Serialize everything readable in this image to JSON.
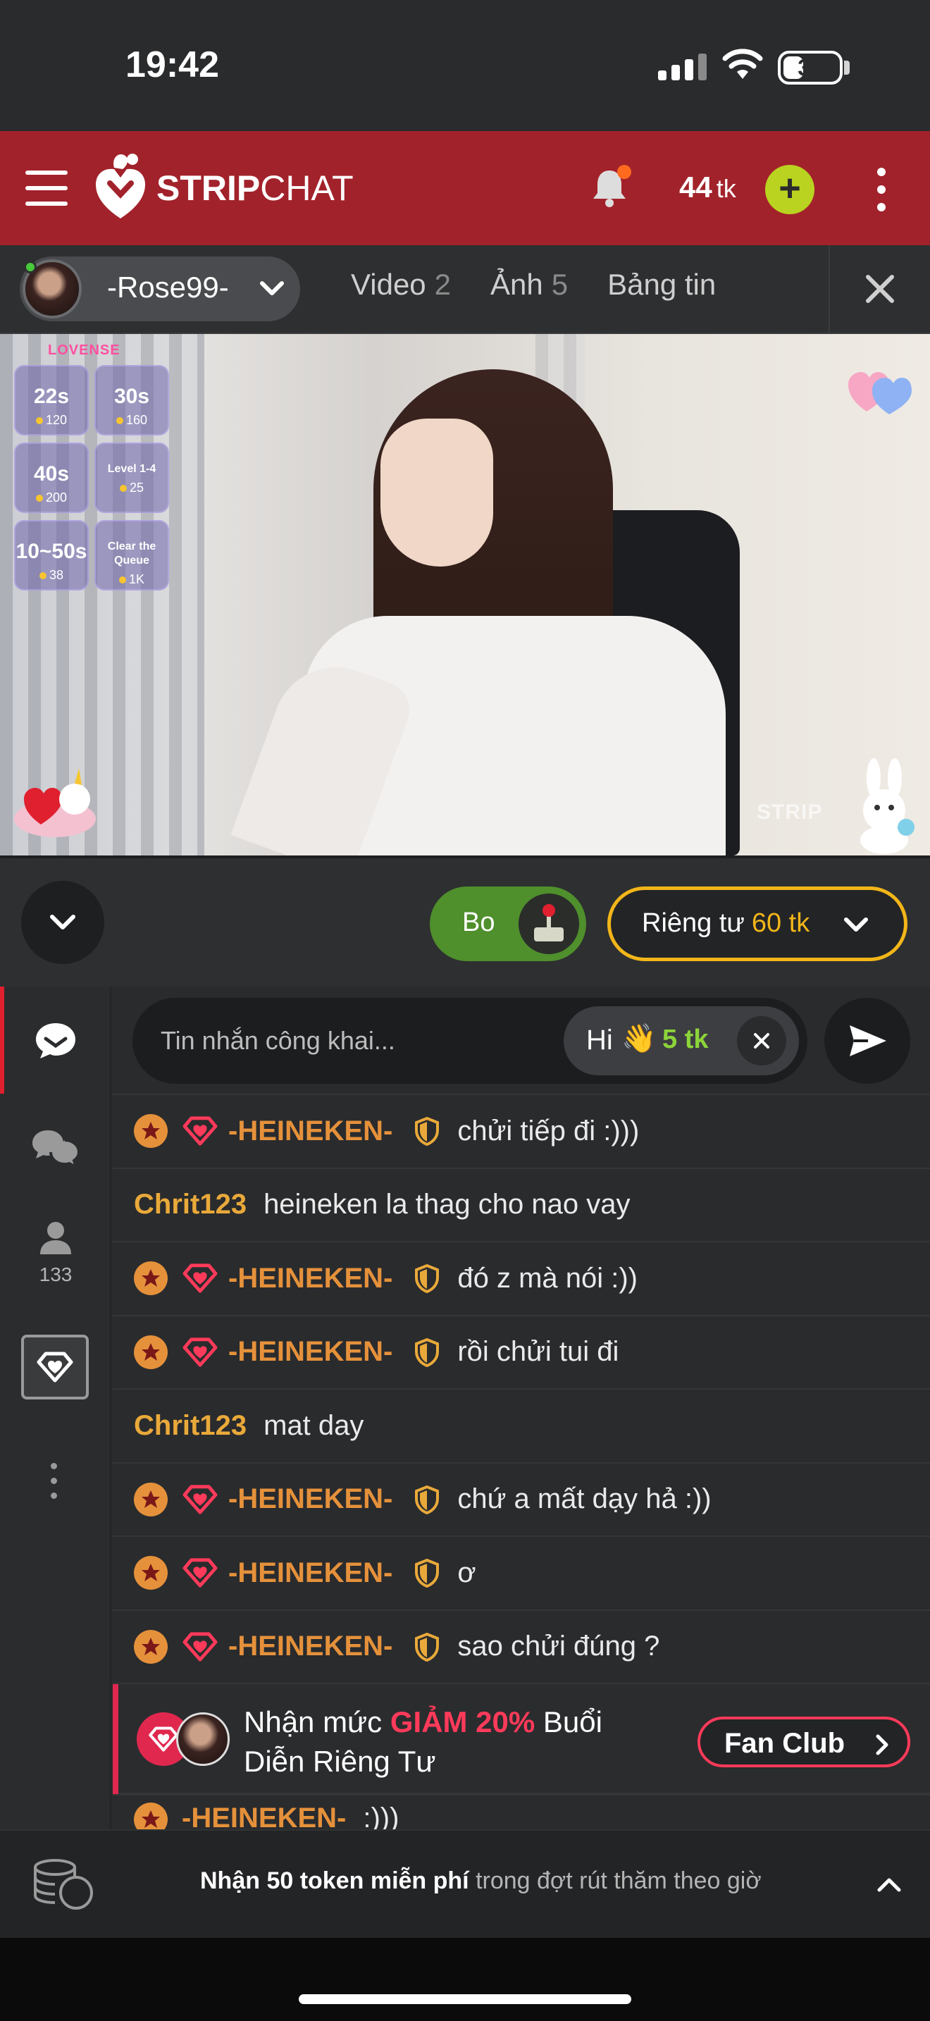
{
  "status_bar": {
    "time": "19:42",
    "battery": "31"
  },
  "header": {
    "logo_bold": "STRIP",
    "logo_light": "CHAT",
    "tokens_value": "44",
    "tokens_unit": "tk",
    "add_label": "+"
  },
  "model_bar": {
    "name": "-Rose99-",
    "tabs": [
      {
        "label": "Video",
        "count": "2"
      },
      {
        "label": "Ảnh",
        "count": "5"
      },
      {
        "label": "Bảng tin",
        "count": ""
      }
    ]
  },
  "video": {
    "lovense_label": "LOVENSE",
    "tiles": [
      {
        "value": "22s",
        "price": "120"
      },
      {
        "value": "30s",
        "price": "160"
      },
      {
        "value": "40s",
        "price": "200"
      },
      {
        "value": "Level 1-4",
        "price": "25"
      },
      {
        "value": "10~50s",
        "price": "38"
      },
      {
        "value": "Clear the Queue",
        "price": "1K"
      }
    ],
    "watermark": "STRIP"
  },
  "controls": {
    "bo_label": "Bo",
    "private_label": "Riêng tư",
    "private_price": "60 tk"
  },
  "side_rail": {
    "users_count": "133"
  },
  "chat": {
    "input_placeholder": "Tin nhắn công khai...",
    "quick_chip": {
      "label": "Hi",
      "emoji": "👋",
      "price": "5 tk"
    },
    "messages": [
      {
        "user": "-HEINEKEN-",
        "text": "chửi tiếp đi :)))",
        "badges": true
      },
      {
        "user": "Chrit123",
        "text": "heineken la thag cho nao vay",
        "badges": false
      },
      {
        "user": "-HEINEKEN-",
        "text": "đó z mà nói :))",
        "badges": true
      },
      {
        "user": "-HEINEKEN-",
        "text": "rồi chửi tui đi",
        "badges": true
      },
      {
        "user": "Chrit123",
        "text": "mat day",
        "badges": false
      },
      {
        "user": "-HEINEKEN-",
        "text": "chứ a mất dạy hả :))",
        "badges": true
      },
      {
        "user": "-HEINEKEN-",
        "text": "ơ",
        "badges": true
      },
      {
        "user": "-HEINEKEN-",
        "text": "sao chửi đúng ?",
        "badges": true
      }
    ],
    "promo": {
      "text_before": "Nhận mức",
      "highlight": "GIẢM 20%",
      "text_after": "Buổi Diễn Riêng Tư",
      "button_label": "Fan Club"
    },
    "partial_message": {
      "user": "-HEINEKEN-",
      "text": ":)))"
    }
  },
  "bottom_banner": {
    "bold_text": "Nhận 50 token miễn phí",
    "rest_text": "trong đợt rút thăm theo giờ"
  },
  "colors": {
    "header_bg": "#a2222b",
    "accent_green": "#b9d320",
    "accent_gold": "#f2b619",
    "username_orange": "#e5913b",
    "fanclub_pink": "#ff3a5a"
  }
}
